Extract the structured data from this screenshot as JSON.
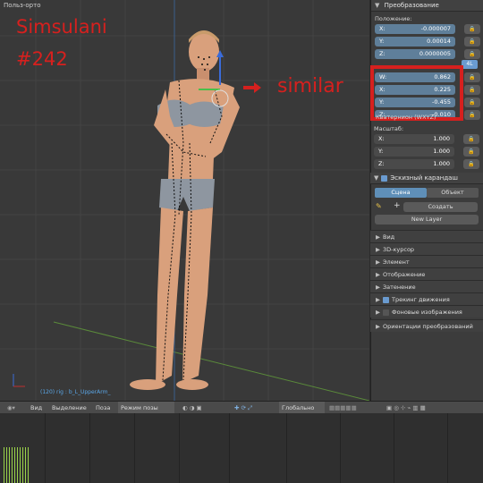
{
  "viewport": {
    "label": "Польз-орто",
    "object_name": "(120) rig : b_L_UpperArm_",
    "annotations": {
      "line1": "Simsulani",
      "line2": "#242",
      "similar": "similar"
    },
    "colors": {
      "accent": "#d6201e",
      "grid": "#444444",
      "skin": "#d9a07c",
      "underwear": "#8e96a0",
      "dark_pose": "#1b1b1b"
    }
  },
  "panel": {
    "transform_header": "Преобразование",
    "location_label": "Положение:",
    "location": [
      {
        "axis": "X:",
        "value": "-0.000007"
      },
      {
        "axis": "Y:",
        "value": "0.00014"
      },
      {
        "axis": "Z:",
        "value": "0.0000005"
      }
    ],
    "rotation_mode_button": "4L",
    "rotation": [
      {
        "axis": "W:",
        "value": "0.862"
      },
      {
        "axis": "X:",
        "value": "0.225"
      },
      {
        "axis": "Y:",
        "value": "-0.455"
      },
      {
        "axis": "Z:",
        "value": "-0.010"
      }
    ],
    "rotation_mode_label": "Кватернион (WXYZ)",
    "scale_label": "Масштаб:",
    "scale": [
      {
        "axis": "X:",
        "value": "1.000"
      },
      {
        "axis": "Y:",
        "value": "1.000"
      },
      {
        "axis": "Z:",
        "value": "1.000"
      }
    ],
    "grease_pencil": {
      "header": "Эскизный карандаш",
      "tab_scene": "Сцена",
      "tab_object": "Объект",
      "create_button": "Создать",
      "new_layer_button": "New Layer"
    },
    "collapsed_sections": [
      "Вид",
      "3D-курсор",
      "Элемент",
      "Отображение",
      "Затенение",
      "Трекинг движения",
      "Фоновые изображения",
      "Ориентации преобразований"
    ]
  },
  "toolbar": {
    "view": "Вид",
    "select": "Выделение",
    "pose": "Поза",
    "mode": "Режим позы",
    "orientation": "Глобально"
  }
}
